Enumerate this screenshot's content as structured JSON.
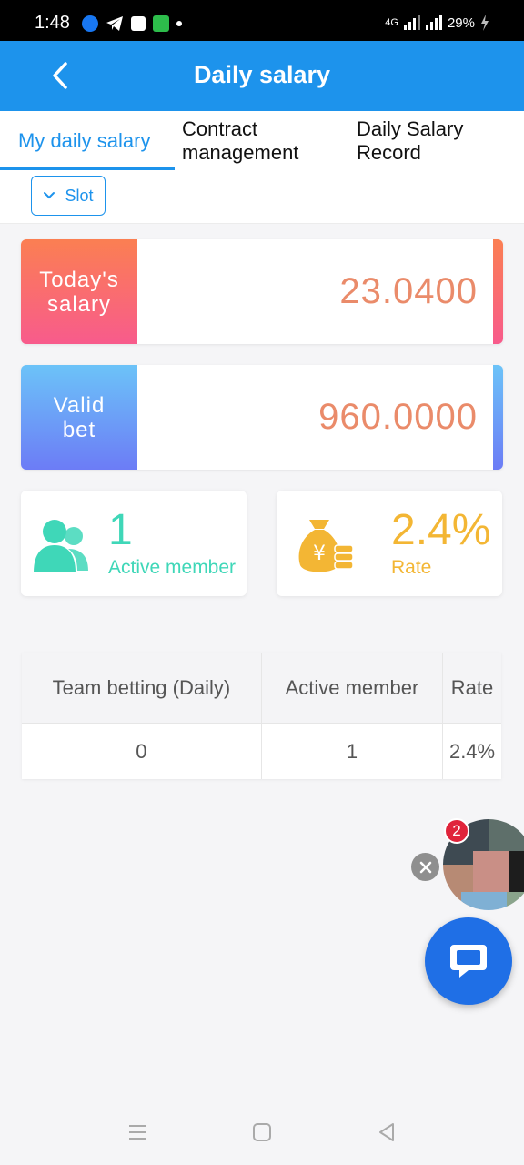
{
  "status_bar": {
    "time": "1:48",
    "network": "4G",
    "battery": "29%"
  },
  "header": {
    "title": "Daily salary"
  },
  "tabs": [
    {
      "label": "My daily salary"
    },
    {
      "label": "Contract management"
    },
    {
      "label": "Daily Salary Record"
    }
  ],
  "filter": {
    "selected": "Slot"
  },
  "cards": {
    "salary": {
      "label_line1": "Today's",
      "label_line2": "salary",
      "value": "23.0400"
    },
    "bet": {
      "label_line1": "Valid",
      "label_line2": "bet",
      "value": "960.0000"
    }
  },
  "stats": {
    "members": {
      "value": "1",
      "label": "Active member"
    },
    "rate": {
      "value": "2.4%",
      "label": "Rate"
    }
  },
  "table": {
    "headers": [
      "Team betting (Daily)",
      "Active member",
      "Rate"
    ],
    "rows": [
      [
        "0",
        "1",
        "2.4%"
      ]
    ]
  },
  "widgets": {
    "badge_count": "2"
  },
  "colors": {
    "primary": "#1d93ec",
    "value_orange": "#ea8b6a",
    "teal": "#3fd7b8",
    "gold": "#f3b634",
    "badge_red": "#e0243b",
    "chat_blue": "#1f6fe6"
  }
}
